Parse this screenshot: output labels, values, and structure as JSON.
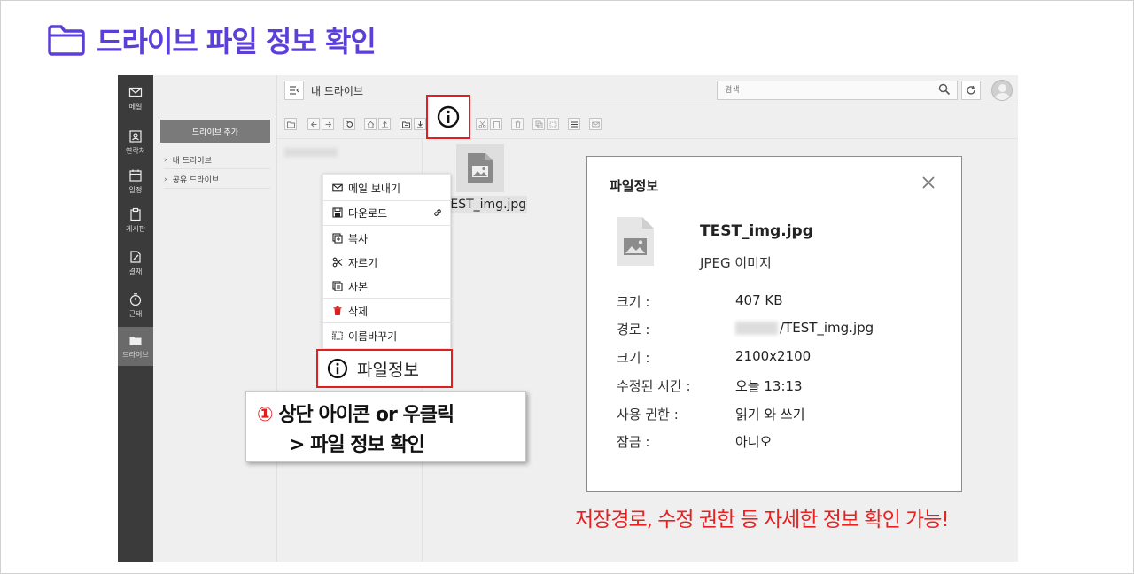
{
  "heading": {
    "text": "드라이브 파일 정보 확인"
  },
  "nav": {
    "items": [
      {
        "label": "메일"
      },
      {
        "label": "연락처"
      },
      {
        "label": "일정"
      },
      {
        "label": "게시판"
      },
      {
        "label": "결재"
      },
      {
        "label": "근태"
      },
      {
        "label": "드라이브"
      }
    ],
    "active": "드라이브"
  },
  "sidebar": {
    "add_button": "드라이브 추가",
    "tree": [
      "내 드라이브",
      "공유 드라이브"
    ]
  },
  "topbar": {
    "title": "내 드라이브",
    "search_placeholder": "검색"
  },
  "file": {
    "name": "TEST_img.jpg"
  },
  "context_menu": {
    "items": [
      "메일 보내기",
      "다운로드",
      "복사",
      "자르기",
      "사본",
      "삭제",
      "이름바꾸기"
    ],
    "highlight_item": "파일정보"
  },
  "callout": {
    "number": "①",
    "line1": "상단 아이콘 or 우클릭",
    "line2": "> 파일 정보 확인"
  },
  "dialog": {
    "title": "파일정보",
    "file_name": "TEST_img.jpg",
    "file_type": "JPEG 이미지",
    "rows": [
      {
        "key": "크기 :",
        "value": "407 KB"
      },
      {
        "key": "경로 :",
        "value": "/TEST_img.jpg"
      },
      {
        "key": "크기 :",
        "value": "2100x2100"
      },
      {
        "key": "수정된 시간 :",
        "value": "오늘 13:13"
      },
      {
        "key": "사용 권한 :",
        "value": "읽기 와 쓰기"
      },
      {
        "key": "잠금 :",
        "value": "아니오"
      }
    ]
  },
  "note": {
    "text": "저장경로, 수정 권한 등 자세한 정보 확인 가능!"
  },
  "colors": {
    "heading": "#5b3fd6",
    "highlight_red": "#e02020",
    "nav_bg": "#3b3b3b"
  }
}
